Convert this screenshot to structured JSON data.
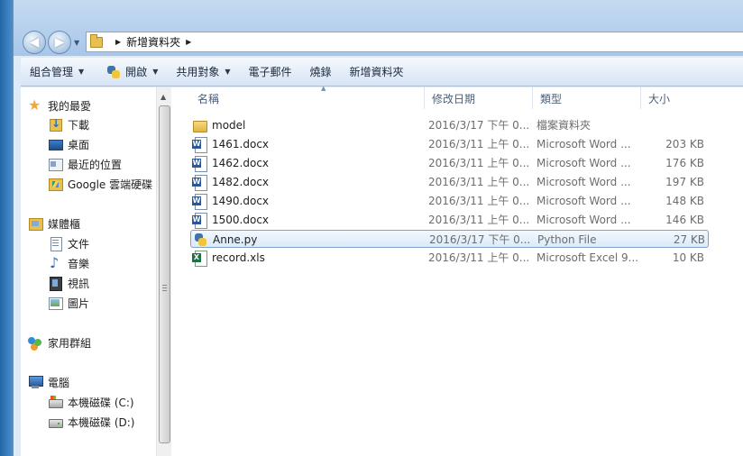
{
  "address": {
    "path": "新增資料夾"
  },
  "toolbar": {
    "organize": "組合管理",
    "open": "開啟",
    "share": "共用對象",
    "email": "電子郵件",
    "burn": "燒錄",
    "new_folder": "新增資料夾"
  },
  "sidebar": {
    "favorites_header": "我的最愛",
    "favorites": [
      {
        "label": "下載",
        "icon": "download-icon"
      },
      {
        "label": "桌面",
        "icon": "desktop-icon"
      },
      {
        "label": "最近的位置",
        "icon": "recent-places-icon"
      },
      {
        "label": "Google 雲端硬碟",
        "icon": "google-drive-icon"
      }
    ],
    "libraries_header": "媒體櫃",
    "libraries": [
      {
        "label": "文件",
        "icon": "documents-icon"
      },
      {
        "label": "音樂",
        "icon": "music-icon"
      },
      {
        "label": "視訊",
        "icon": "video-icon"
      },
      {
        "label": "圖片",
        "icon": "pictures-icon"
      }
    ],
    "homegroup": "家用群組",
    "computer_header": "電腦",
    "drives": [
      {
        "label": "本機磁碟 (C:)",
        "icon": "drive-c-icon"
      },
      {
        "label": "本機磁碟 (D:)",
        "icon": "drive-d-icon"
      }
    ]
  },
  "columns": {
    "name": "名稱",
    "date": "修改日期",
    "type": "類型",
    "size": "大小"
  },
  "files": [
    {
      "name": "model",
      "date": "2016/3/17 下午 0...",
      "type": "檔案資料夾",
      "size": "",
      "icon": "folder-icon"
    },
    {
      "name": "1461.docx",
      "date": "2016/3/11 上午 0...",
      "type": "Microsoft Word ...",
      "size": "203 KB",
      "icon": "word-icon"
    },
    {
      "name": "1462.docx",
      "date": "2016/3/11 上午 0...",
      "type": "Microsoft Word ...",
      "size": "176 KB",
      "icon": "word-icon"
    },
    {
      "name": "1482.docx",
      "date": "2016/3/11 上午 0...",
      "type": "Microsoft Word ...",
      "size": "197 KB",
      "icon": "word-icon"
    },
    {
      "name": "1490.docx",
      "date": "2016/3/11 上午 0...",
      "type": "Microsoft Word ...",
      "size": "148 KB",
      "icon": "word-icon"
    },
    {
      "name": "1500.docx",
      "date": "2016/3/11 上午 0...",
      "type": "Microsoft Word ...",
      "size": "146 KB",
      "icon": "word-icon"
    },
    {
      "name": "Anne.py",
      "date": "2016/3/17 下午 0...",
      "type": "Python File",
      "size": "27 KB",
      "icon": "python-icon",
      "selected": true
    },
    {
      "name": "record.xls",
      "date": "2016/3/11 上午 0...",
      "type": "Microsoft Excel 9...",
      "size": "10 KB",
      "icon": "excel-icon"
    }
  ]
}
